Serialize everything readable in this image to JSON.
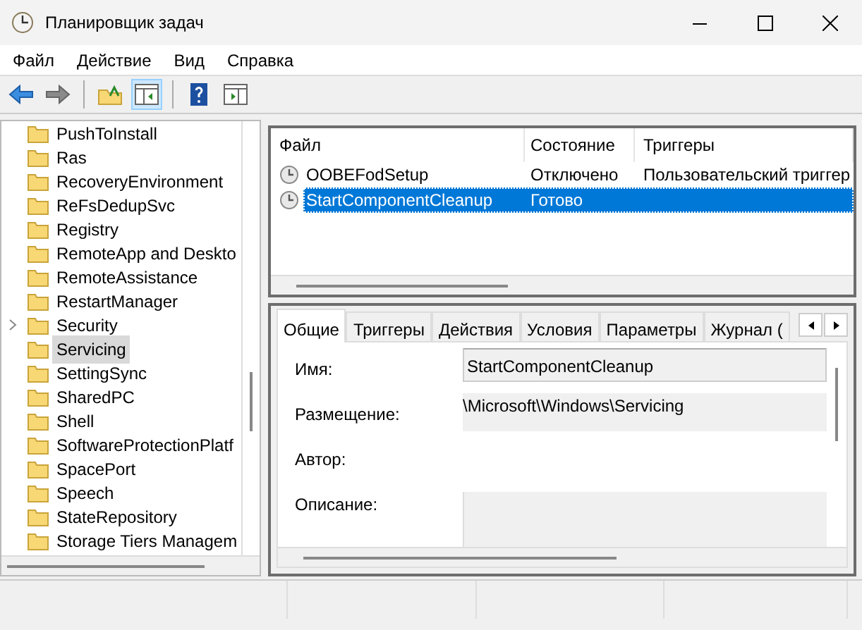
{
  "window": {
    "title": "Планировщик задач"
  },
  "menu": [
    "Файл",
    "Действие",
    "Вид",
    "Справка"
  ],
  "tree": [
    {
      "label": "PushToInstall",
      "has_children": false,
      "selected": false
    },
    {
      "label": "Ras",
      "has_children": false,
      "selected": false
    },
    {
      "label": "RecoveryEnvironment",
      "has_children": false,
      "selected": false
    },
    {
      "label": "ReFsDedupSvc",
      "has_children": false,
      "selected": false
    },
    {
      "label": "Registry",
      "has_children": false,
      "selected": false
    },
    {
      "label": "RemoteApp and Deskto",
      "has_children": false,
      "selected": false
    },
    {
      "label": "RemoteAssistance",
      "has_children": false,
      "selected": false
    },
    {
      "label": "RestartManager",
      "has_children": false,
      "selected": false
    },
    {
      "label": "Security",
      "has_children": true,
      "selected": false
    },
    {
      "label": "Servicing",
      "has_children": false,
      "selected": true
    },
    {
      "label": "SettingSync",
      "has_children": false,
      "selected": false
    },
    {
      "label": "SharedPC",
      "has_children": false,
      "selected": false
    },
    {
      "label": "Shell",
      "has_children": false,
      "selected": false
    },
    {
      "label": "SoftwareProtectionPlatf",
      "has_children": false,
      "selected": false
    },
    {
      "label": "SpacePort",
      "has_children": false,
      "selected": false
    },
    {
      "label": "Speech",
      "has_children": false,
      "selected": false
    },
    {
      "label": "StateRepository",
      "has_children": false,
      "selected": false
    },
    {
      "label": "Storage Tiers Managem",
      "has_children": false,
      "selected": false
    }
  ],
  "task_table": {
    "columns": [
      "Файл",
      "Состояние",
      "Триггеры"
    ],
    "rows": [
      {
        "cells": [
          "OOBEFodSetup",
          "Отключено",
          "Пользовательский триггер"
        ],
        "selected": false
      },
      {
        "cells": [
          "StartComponentCleanup",
          "Готово"
        ],
        "selected": true
      }
    ]
  },
  "tabs": [
    {
      "label": "Общие",
      "selected": true
    },
    {
      "label": "Триггеры",
      "selected": false
    },
    {
      "label": "Действия",
      "selected": false
    },
    {
      "label": "Условия",
      "selected": false
    },
    {
      "label": "Параметры",
      "selected": false
    },
    {
      "label": "Журнал (",
      "selected": false
    }
  ],
  "general": [
    {
      "label": "Имя:",
      "kind": "field",
      "value": "StartComponentCleanup"
    },
    {
      "label": "Размещение:",
      "kind": "readonly",
      "value": "\\Microsoft\\Windows\\Servicing"
    },
    {
      "label": "Автор:",
      "kind": "plain"
    },
    {
      "label": "Описание:",
      "kind": "area"
    }
  ]
}
